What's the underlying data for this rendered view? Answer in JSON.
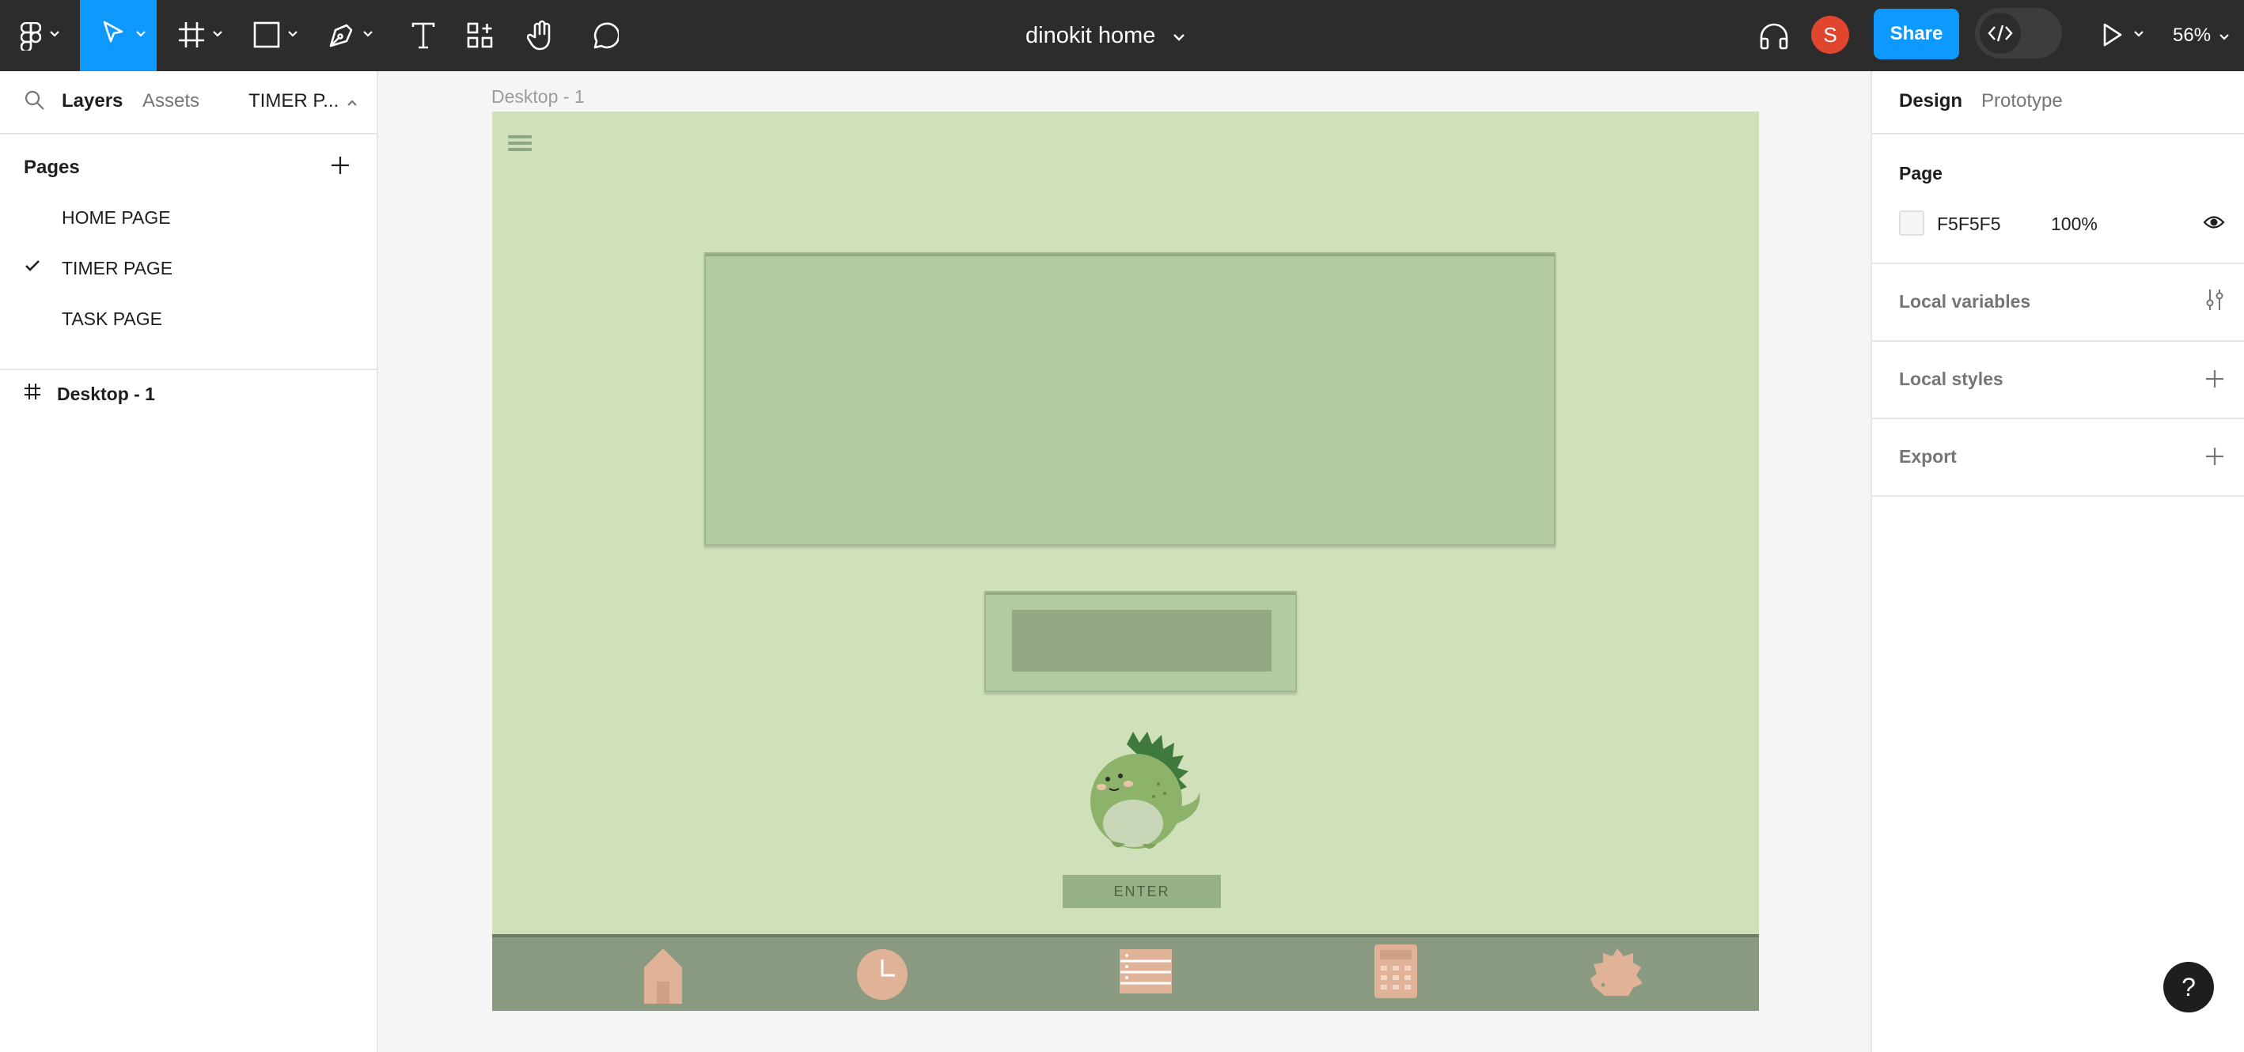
{
  "toolbar": {
    "tools": [
      {
        "name": "main-menu",
        "icon": "figma-logo-icon",
        "active": false
      },
      {
        "name": "move",
        "icon": "cursor-arrow-icon",
        "active": true
      },
      {
        "name": "frame",
        "icon": "frame-hash-icon",
        "active": false
      },
      {
        "name": "shape",
        "icon": "rectangle-icon",
        "active": false
      },
      {
        "name": "pen",
        "icon": "pen-icon",
        "active": false
      },
      {
        "name": "text",
        "icon": "text-T-icon",
        "active": false
      },
      {
        "name": "resources",
        "icon": "components-icon",
        "active": false
      },
      {
        "name": "hand",
        "icon": "hand-icon",
        "active": false
      },
      {
        "name": "comment",
        "icon": "speech-bubble-icon",
        "active": false
      }
    ],
    "file_title": "dinokit home",
    "avatar_initial": "S",
    "share_label": "Share",
    "zoom": "56%",
    "colors": {
      "bg": "#2c2c2c",
      "accent": "#0d99ff",
      "avatar": "#e0462d"
    }
  },
  "left_panel": {
    "tabs": [
      {
        "label": "Layers",
        "active": true
      },
      {
        "label": "Assets",
        "active": false
      }
    ],
    "page_selector": "TIMER P...",
    "pages_header": "Pages",
    "pages": [
      {
        "label": "HOME PAGE",
        "selected": false
      },
      {
        "label": "TIMER PAGE",
        "selected": true
      },
      {
        "label": "TASK PAGE",
        "selected": false
      }
    ],
    "layers": [
      {
        "label": "Desktop - 1",
        "icon": "frame-hash-icon"
      }
    ]
  },
  "canvas": {
    "background": "#f5f5f5",
    "frame_label": "Desktop - 1",
    "frame": {
      "background": "#cfe0bb",
      "enter_label": "ENTER",
      "nav_icons": [
        "house-icon",
        "clock-icon",
        "list-icon",
        "calculator-icon",
        "hedgehog-icon"
      ],
      "nav_color": "#8a9a80",
      "icon_color": "#e0b298"
    }
  },
  "right_panel": {
    "tabs": [
      {
        "label": "Design",
        "active": true
      },
      {
        "label": "Prototype",
        "active": false
      }
    ],
    "page_section": {
      "title": "Page",
      "fill_hex": "F5F5F5",
      "fill_opacity": "100%"
    },
    "sections": [
      {
        "title": "Local variables",
        "icon": "sliders-icon"
      },
      {
        "title": "Local styles",
        "icon": "plus-icon"
      },
      {
        "title": "Export",
        "icon": "plus-icon"
      }
    ]
  },
  "help_label": "?"
}
